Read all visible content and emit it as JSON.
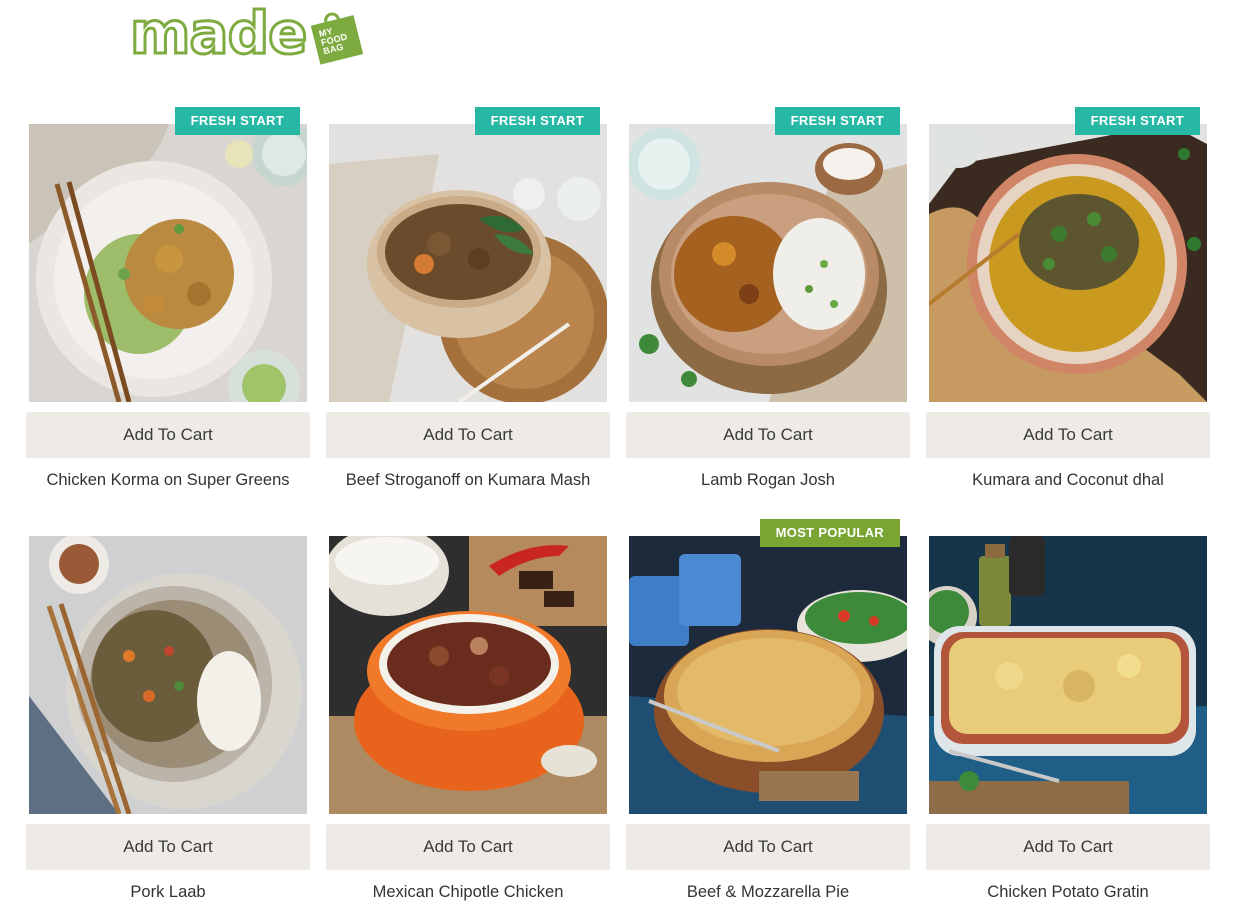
{
  "brand": {
    "logo_word": "made",
    "bag_text": [
      "MY",
      "FOOD",
      "BAG"
    ],
    "color": "#7dab3f"
  },
  "badge_colors": {
    "fresh_start": "#27b8a5",
    "most_popular": "#7aa533"
  },
  "products": [
    {
      "name": "Chicken Korma on Super Greens",
      "badge": "FRESH START",
      "badge_type": "fresh_start",
      "cta": "Add To Cart",
      "photo": "chicken-korma-photo"
    },
    {
      "name": "Beef Stroganoff on Kumara Mash",
      "badge": "FRESH START",
      "badge_type": "fresh_start",
      "cta": "Add To Cart",
      "photo": "beef-stroganoff-photo"
    },
    {
      "name": "Lamb Rogan Josh",
      "badge": "FRESH START",
      "badge_type": "fresh_start",
      "cta": "Add To Cart",
      "photo": "lamb-rogan-josh-photo"
    },
    {
      "name": "Kumara and Coconut dhal",
      "badge": "FRESH START",
      "badge_type": "fresh_start",
      "cta": "Add To Cart",
      "photo": "kumara-dhal-photo"
    },
    {
      "name": "Pork Laab",
      "badge": "",
      "badge_type": "",
      "cta": "Add To Cart",
      "photo": "pork-laab-photo"
    },
    {
      "name": "Mexican Chipotle Chicken",
      "badge": "",
      "badge_type": "",
      "cta": "Add To Cart",
      "photo": "mexican-chipotle-photo"
    },
    {
      "name": "Beef & Mozzarella Pie",
      "badge": "MOST POPULAR",
      "badge_type": "most_popular",
      "cta": "Add To Cart",
      "photo": "beef-pie-photo"
    },
    {
      "name": "Chicken Potato Gratin",
      "badge": "",
      "badge_type": "",
      "cta": "Add To Cart",
      "photo": "chicken-gratin-photo"
    }
  ]
}
